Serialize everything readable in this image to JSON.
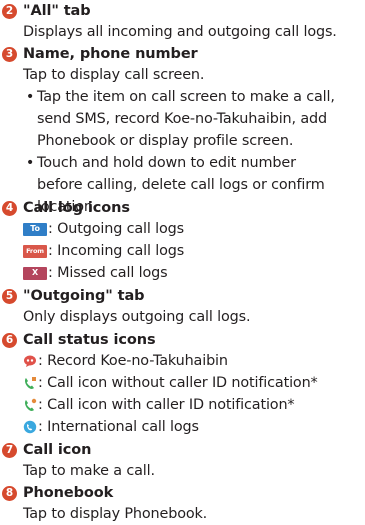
{
  "sections": [
    {
      "num": "2",
      "title": "\"All\" tab",
      "text": "Displays all incoming and outgoing call logs."
    },
    {
      "num": "3",
      "title": "Name, phone number",
      "text": "Tap to display call screen.",
      "bullets": [
        [
          "Tap the item on call screen to make a call,",
          "send SMS, record Koe-no-Takuhaibin, add",
          "Phonebook or display profile screen."
        ],
        [
          "Touch and hold down to edit number",
          "before calling, delete call logs or confirm",
          "location."
        ]
      ]
    },
    {
      "num": "4",
      "title": "Call log icons",
      "rows": [
        {
          "badge": "To",
          "text": ": Outgoing call logs"
        },
        {
          "badge": "From",
          "text": ": Incoming call logs"
        },
        {
          "badge": "X",
          "text": ": Missed call logs"
        }
      ]
    },
    {
      "num": "5",
      "title": "\"Outgoing\" tab",
      "text": "Only displays outgoing call logs."
    },
    {
      "num": "6",
      "title": "Call status icons",
      "rows": [
        {
          "icon": "voice-message-icon",
          "text": ": Record Koe-no-Takuhaibin"
        },
        {
          "icon": "call-no-caller-id-icon",
          "text": ": Call icon without caller ID notification*"
        },
        {
          "icon": "call-with-caller-id-icon",
          "text": ": Call icon with caller ID notification*"
        },
        {
          "icon": "international-call-icon",
          "text": ": International call logs"
        }
      ]
    },
    {
      "num": "7",
      "title": "Call icon",
      "text": "Tap to make a call."
    },
    {
      "num": "8",
      "title": "Phonebook",
      "text": "Tap to display Phonebook."
    }
  ],
  "bullet_char": "•",
  "colors": {
    "number_badge": "#d64a2e",
    "to_badge": "#2f7ec7",
    "from_badge": "#d9574a",
    "missed_badge": "#b4455d"
  }
}
